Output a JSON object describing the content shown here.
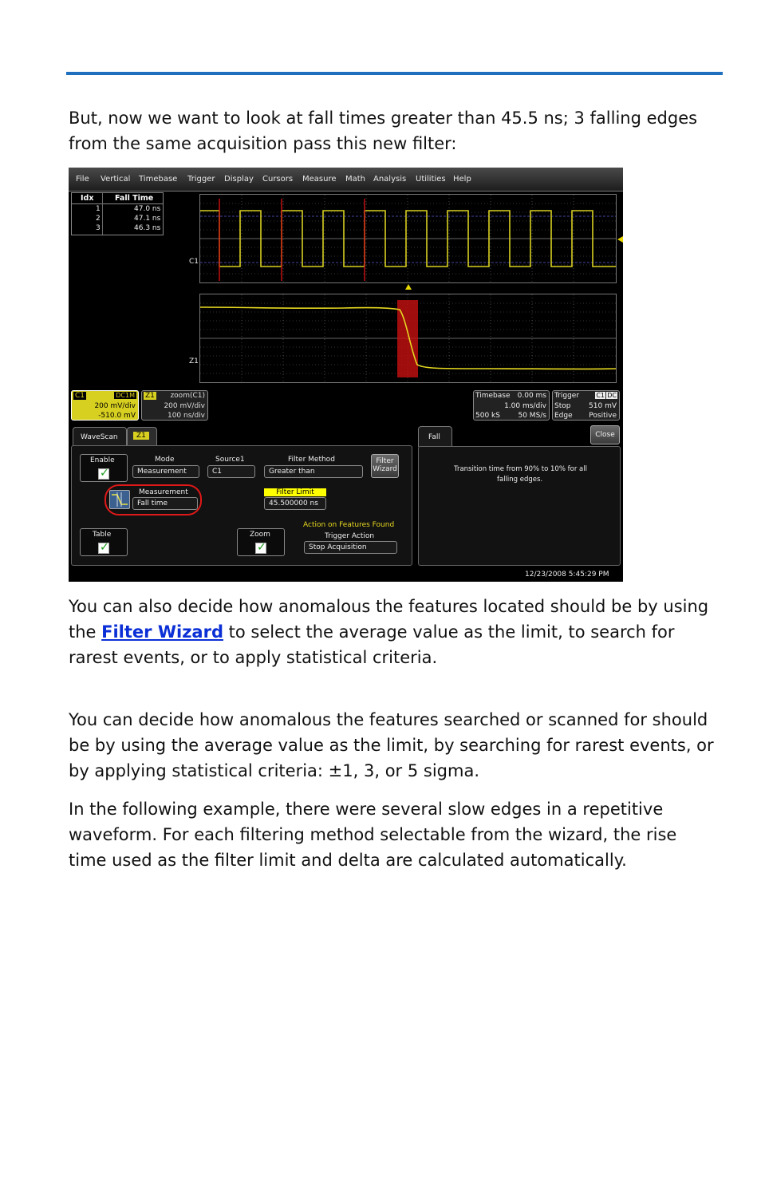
{
  "doc": {
    "p1": "But, now we want to look at fall times greater than 45.5 ns; 3 falling edges from the same acquisition pass this new filter:",
    "p2_before": "You can also decide how anomalous the features located should be by using the ",
    "p2_link": "Filter Wizard",
    "p2_after": " to select the average value as the limit, to search for rarest events, or to apply statistical criteria.",
    "p3": "You can decide how anomalous the features searched or scanned for should be by using the average value as the limit, by searching for rarest events, or by applying statistical criteria: ±1, 3, or 5 sigma.",
    "p4": "In the following example, there were several slow edges in a repetitive waveform. For each filtering method selectable from the wizard, the rise time used as the filter limit and delta are calculated automatically."
  },
  "scope": {
    "menu": [
      "File",
      "Vertical",
      "Timebase",
      "Trigger",
      "Display",
      "Cursors",
      "Measure",
      "Math",
      "Analysis",
      "Utilities",
      "Help"
    ],
    "table": {
      "col_idx": "Idx",
      "col_val": "Fall Time",
      "rows": [
        {
          "idx": "1",
          "val": "47.0 ns"
        },
        {
          "idx": "2",
          "val": "47.1 ns"
        },
        {
          "idx": "3",
          "val": "46.3 ns"
        }
      ]
    },
    "trace_label_top": "C1",
    "trace_label_zoom": "Z1",
    "c1": {
      "tag": "C1",
      "coupling": "DC1M",
      "vdiv": "200 mV/div",
      "offset": "-510.0 mV"
    },
    "z1": {
      "tag": "Z1",
      "name": "zoom(C1)",
      "vdiv": "200 mV/div",
      "tdiv": "100 ns/div"
    },
    "timebase": {
      "label": "Timebase",
      "delay": "0.00 ms",
      "tdiv": "1.00 ms/div",
      "samples": "500 kS",
      "rate": "50 MS/s"
    },
    "trigger": {
      "label": "Trigger",
      "src": "C1",
      "coupling": "DC",
      "mode": "Stop",
      "level": "510 mV",
      "type": "Edge",
      "slope": "Positive"
    },
    "wavescan": {
      "tab": "WaveScan",
      "tab2": "Z1",
      "enable_label": "Enable",
      "mode_label": "Mode",
      "mode_value": "Measurement",
      "source_label": "Source1",
      "source_value": "C1",
      "filter_method_label": "Filter Method",
      "filter_method_value": "Greater than",
      "filter_wizard_line1": "Filter",
      "filter_wizard_line2": "Wizard",
      "measurement_label": "Measurement",
      "measurement_value": "Fall time",
      "filter_limit_label": "Filter Limit",
      "filter_limit_value": "45.500000 ns",
      "table_label": "Table",
      "zoom_label": "Zoom",
      "action_label": "Action on Features Found",
      "trigger_action_label": "Trigger Action",
      "trigger_action_value": "Stop Acquisition"
    },
    "fall": {
      "tab": "Fall",
      "close": "Close",
      "desc1": "Transition time from 90% to 10% for all",
      "desc2": "falling edges."
    },
    "datetime": "12/23/2008 5:45:29 PM",
    "colors": {
      "trace": "#d8d020",
      "marker": "#cc1111",
      "highlight": "#ffff00"
    }
  }
}
